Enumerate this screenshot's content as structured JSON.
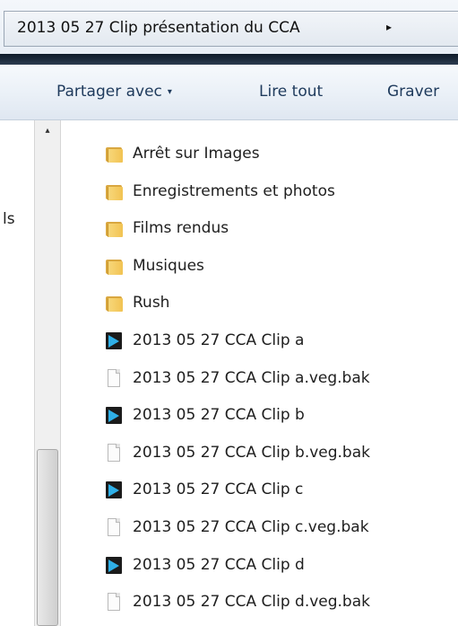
{
  "address": {
    "path": "2013 05 27 Clip présentation du CCA",
    "arrow": "▸"
  },
  "toolbar": {
    "share": "Partager avec",
    "share_arrow": "▾",
    "play_all": "Lire tout",
    "burn": "Graver"
  },
  "nav": {
    "fragment": "ls"
  },
  "scrollbar": {
    "up_arrow": "▴"
  },
  "files": [
    {
      "name": "Arrêt sur Images",
      "icon": "folder-icon"
    },
    {
      "name": "Enregistrements et photos",
      "icon": "folder-icon"
    },
    {
      "name": "Films rendus",
      "icon": "folder-icon"
    },
    {
      "name": "Musiques",
      "icon": "folder-icon"
    },
    {
      "name": "Rush",
      "icon": "folder-icon"
    },
    {
      "name": "2013 05 27 CCA Clip a",
      "icon": "video-icon"
    },
    {
      "name": "2013 05 27 CCA Clip a.veg.bak",
      "icon": "file-icon"
    },
    {
      "name": "2013 05 27 CCA Clip b",
      "icon": "video-icon"
    },
    {
      "name": "2013 05 27 CCA Clip b.veg.bak",
      "icon": "file-icon"
    },
    {
      "name": "2013 05 27 CCA Clip c",
      "icon": "video-icon"
    },
    {
      "name": "2013 05 27 CCA Clip c.veg.bak",
      "icon": "file-icon"
    },
    {
      "name": "2013 05 27 CCA Clip d",
      "icon": "video-icon"
    },
    {
      "name": "2013 05 27 CCA Clip d.veg.bak",
      "icon": "file-icon"
    }
  ]
}
